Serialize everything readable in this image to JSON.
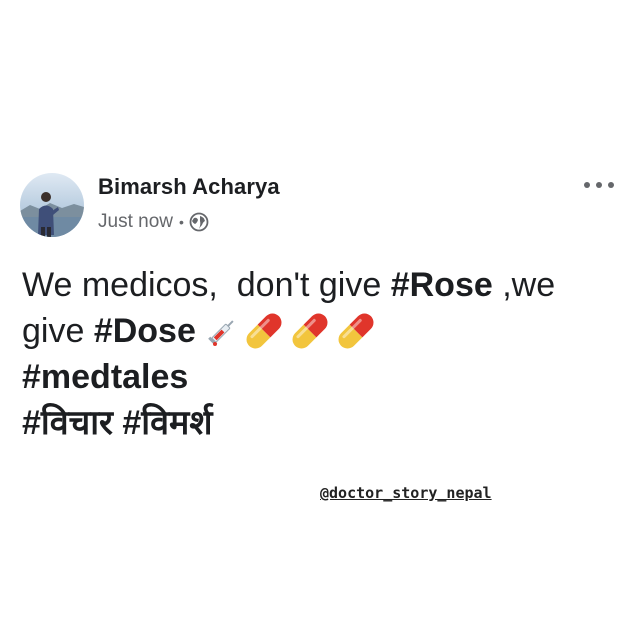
{
  "post": {
    "author": {
      "name": "Bimarsh Acharya",
      "avatar": "avatar-photo"
    },
    "meta": {
      "time": "Just now",
      "separator": "•",
      "privacy_icon": "globe-icon"
    },
    "more_icon": "more-horizontal-icon",
    "lines": [
      {
        "parts": [
          {
            "text": "We medicos,  don't give "
          },
          {
            "text": "#Rose"
          },
          {
            "text": " ,we"
          }
        ]
      },
      {
        "parts": [
          {
            "text": "give "
          },
          {
            "text": "#Dose"
          }
        ],
        "emojis": [
          "syringe-emoji",
          "pill-emoji",
          "pill-emoji",
          "pill-emoji"
        ]
      },
      {
        "parts": [
          {
            "text": "#medtales"
          }
        ]
      },
      {
        "parts": [
          {
            "text": "#विचार #विमर्श"
          }
        ]
      }
    ]
  },
  "watermark": "@doctor_story_nepal",
  "colors": {
    "name": "#1c1e21",
    "meta": "#65676b",
    "pill_red": "#e0352b",
    "pill_yellow": "#f2c53d"
  }
}
